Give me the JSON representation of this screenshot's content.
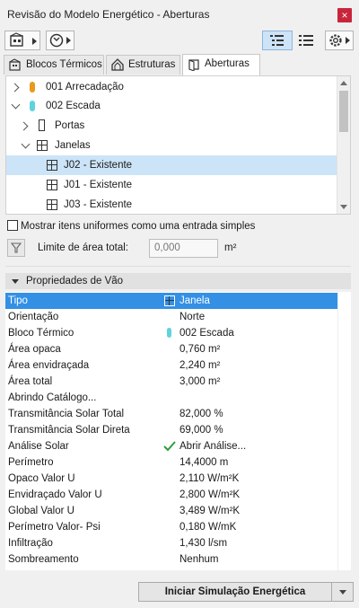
{
  "window": {
    "title": "Revisão do Modelo Energético - Aberturas",
    "close_label": "×"
  },
  "tabs": [
    {
      "label": "Blocos Térmicos",
      "icon": "thermal-blocks-icon"
    },
    {
      "label": "Estruturas",
      "icon": "structures-icon"
    },
    {
      "label": "Aberturas",
      "icon": "openings-icon"
    }
  ],
  "tree": {
    "items": [
      {
        "label": "001 Arrecadação",
        "kind": "block",
        "color": "#e89a1b",
        "level": 0,
        "expanded": false
      },
      {
        "label": "002 Escada",
        "kind": "block",
        "color": "#5fd3dd",
        "level": 0,
        "expanded": true
      },
      {
        "label": "Portas",
        "kind": "door-group",
        "level": 1,
        "expanded": false
      },
      {
        "label": "Janelas",
        "kind": "window-group",
        "level": 1,
        "expanded": true
      },
      {
        "label": "J02 - Existente",
        "kind": "window",
        "level": 2,
        "selected": true
      },
      {
        "label": "J01 - Existente",
        "kind": "window",
        "level": 2
      },
      {
        "label": "J03 - Existente",
        "kind": "window",
        "level": 2
      }
    ]
  },
  "options": {
    "uniform_checkbox_label": "Mostrar itens uniformes como uma entrada simples",
    "uniform_checked": false,
    "area_limit_label": "Limite de área total:",
    "area_limit_value": "0,000",
    "area_unit": "m²"
  },
  "properties": {
    "header": "Propriedades de Vão",
    "rows": [
      {
        "name": "Tipo",
        "value": "Janela",
        "icon": "window-icon",
        "selected": true
      },
      {
        "name": "Orientação",
        "value": "Norte"
      },
      {
        "name": "Bloco Térmico",
        "value": "002 Escada",
        "icon": "block-color-icon",
        "color": "#5fd3dd"
      },
      {
        "name": "Área opaca",
        "value": "0,760 m²"
      },
      {
        "name": "Área envidraçada",
        "value": "2,240 m²"
      },
      {
        "name": "Área total",
        "value": "3,000 m²"
      },
      {
        "name": "Abrindo Catálogo...",
        "value": ""
      },
      {
        "name": "Transmitância Solar Total",
        "value": "82,000 %"
      },
      {
        "name": "Transmitância Solar Direta",
        "value": "69,000 %"
      },
      {
        "name": "Análise Solar",
        "value": "Abrir Análise...",
        "icon": "checkmark-icon",
        "color": "#2e9e3e"
      },
      {
        "name": "Perímetro",
        "value": "14,4000 m"
      },
      {
        "name": "Opaco Valor U",
        "value": "2,110 W/m²K"
      },
      {
        "name": "Envidraçado Valor U",
        "value": "2,800 W/m²K"
      },
      {
        "name": "Global Valor U",
        "value": "3,489 W/m²K"
      },
      {
        "name": "Perímetro Valor- Psi",
        "value": "0,180 W/mK"
      },
      {
        "name": "Infiltração",
        "value": "1,430 l/sm"
      },
      {
        "name": "Sombreamento",
        "value": "Nenhum"
      }
    ]
  },
  "footer": {
    "start_button": "Iniciar Simulação Energética"
  }
}
